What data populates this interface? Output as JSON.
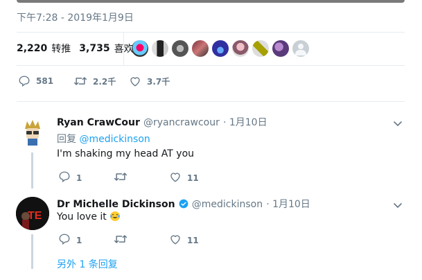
{
  "tweet": {
    "timestamp": "下午7:28 - 2019年1月9日",
    "retweets_count": "2,220",
    "retweets_label": "转推",
    "likes_count": "3,735",
    "likes_label": "喜欢",
    "reply_count": "581",
    "retweet_count_short": "2.2千",
    "like_count_short": "3.7千"
  },
  "replies": [
    {
      "name": "Ryan CrawCour",
      "handle": "@ryancrawcour",
      "date": "· 1月10日",
      "reply_to_prefix": "回复",
      "reply_to_handle": "@medickinson",
      "text": "I'm shaking my head AT you",
      "reply_count": "1",
      "like_count": "11"
    },
    {
      "name": "Dr Michelle Dickinson",
      "handle": "@medickinson",
      "date": "· 1月10日",
      "text": "You love it",
      "reply_count": "1",
      "like_count": "11"
    }
  ],
  "more_replies": "另外 1 条回复",
  "colors": {
    "accent": "#1da1f2",
    "muted": "#657786",
    "divider": "#e6ecf0"
  }
}
